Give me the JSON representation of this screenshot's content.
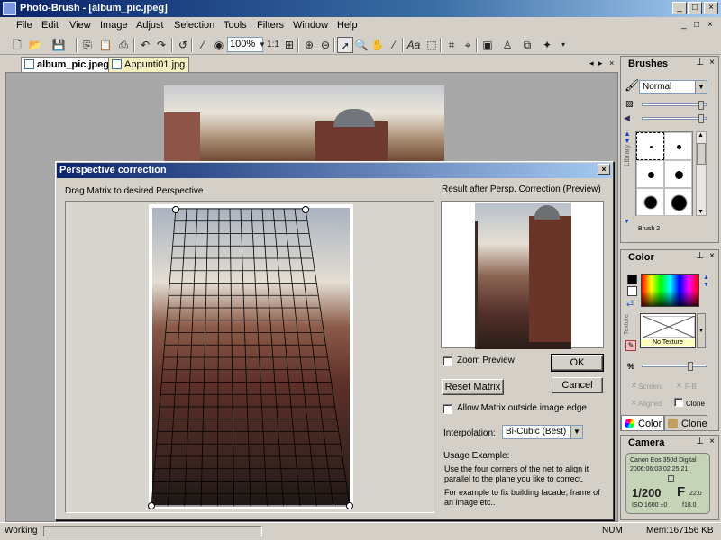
{
  "window": {
    "title": "Photo-Brush - [album_pic.jpeg]",
    "buttons": [
      "_",
      "□",
      "×"
    ]
  },
  "menu": {
    "items": [
      "File",
      "Edit",
      "View",
      "Image",
      "Adjust",
      "Selection",
      "Tools",
      "Filters",
      "Window",
      "Help"
    ],
    "mdi_buttons": [
      "_",
      "□",
      "×"
    ]
  },
  "toolbar": {
    "zoom": "100%",
    "one_to_one": "1:1"
  },
  "tabs": {
    "items": [
      "album_pic.jpeg",
      "Appunti01.jpg"
    ],
    "nav": [
      "◂",
      "▸",
      "×"
    ]
  },
  "statusbar": {
    "left": "Working",
    "num": "NUM",
    "mem": "Mem:167156 KB"
  },
  "brushes_panel": {
    "title": "Brushes",
    "mode": "Normal",
    "library_label": "Library",
    "brush_name": "Brush 2"
  },
  "color_panel": {
    "title": "Color",
    "texture_label": "Texture",
    "texture_name": "No Texture",
    "percent": "%",
    "screen": "Screen",
    "fb": "F-B",
    "aligned": "Aligned",
    "clone_chk": "Clone",
    "tab_color": "Color",
    "tab_clone": "Clone"
  },
  "camera_panel": {
    "title": "Camera",
    "model": "Canon Eos 350d Digital",
    "datetime": "2006:06:03 02:25:21",
    "shutter": "1/200",
    "fnumber": "F",
    "fvalue": "22.0",
    "iso": "ISO 1600 ±0",
    "focal": "f18.0"
  },
  "dialog": {
    "title": "Perspective correction",
    "left_label": "Drag Matrix to desired Perspective",
    "right_label": "Result after Persp. Correction (Preview)",
    "zoom_preview": "Zoom Preview",
    "ok": "OK",
    "cancel": "Cancel",
    "reset": "Reset Matrix",
    "allow": "Allow Matrix outside image edge",
    "interp_label": "Interpolation:",
    "interp_value": "Bi-Cubic (Best)",
    "usage_title": "Usage Example:",
    "usage_text1": "Use the four corners of the net to align it parallel to the plane you like to correct.",
    "usage_text2": "For example to fix building facade, frame of an image etc.."
  }
}
